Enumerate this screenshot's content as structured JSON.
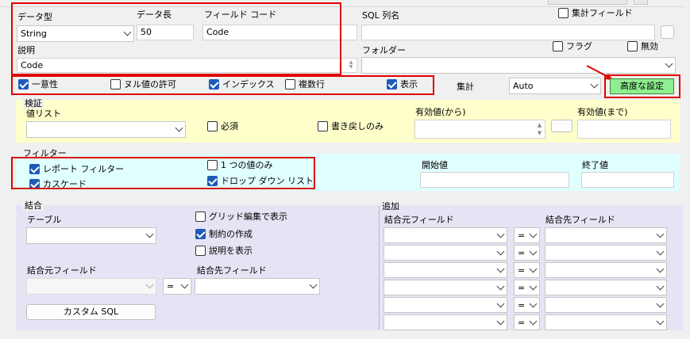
{
  "colors": {
    "accent": "#1e5bb8",
    "highlight": "#e00000",
    "valid_panel": "#ffffcc",
    "filter_panel": "#e0ffff",
    "join_panel": "#e4e4f4",
    "advanced_button_bg": "#90ee90"
  },
  "fields": {
    "data_type_label": "データ型",
    "data_type_value": "String",
    "data_length_label": "データ長",
    "data_length_value": "50",
    "field_code_label": "フィールド コード",
    "field_code_value": "Code",
    "description_label": "説明",
    "description_value": "Code",
    "sql_name_label": "SQL 列名",
    "sql_name_value": "",
    "aggregate_field_label": "集計フィールド",
    "folder_label": "フォルダー",
    "folder_value": "",
    "flag_label": "フラグ",
    "disabled_label": "無効"
  },
  "attrs": {
    "unique_label": "一意性",
    "nullable_label": "ヌル値の許可",
    "index_label": "インデックス",
    "multiline_label": "複数行",
    "display_label": "表示",
    "aggregate_label": "集計",
    "aggregate_value": "Auto",
    "advanced_button": "高度な設定"
  },
  "validation": {
    "title": "検証",
    "value_list_label": "値リスト",
    "required_label": "必須",
    "writeback_only_label": "書き戻しのみ",
    "valid_from_label": "有効値(から)",
    "valid_to_label": "有効値(まで)"
  },
  "filter": {
    "title": "フィルター",
    "report_filter_label": "レポート フィルター",
    "cascade_label": "カスケード",
    "single_value_label": "1 つの値のみ",
    "dropdown_list_label": "ドロップ ダウン リスト",
    "start_label": "開始値",
    "end_label": "終了値"
  },
  "join": {
    "title": "結合",
    "table_label": "テーブル",
    "show_grid_edit_label": "グリッド編集で表示",
    "create_constraint_label": "制約の作成",
    "show_description_label": "説明を表示",
    "source_field_label": "結合元フィールド",
    "target_field_label": "結合先フィールド",
    "operator": "=",
    "custom_sql_button": "カスタム SQL",
    "add_title": "追加",
    "add_source_label": "結合元フィールド",
    "add_target_label": "結合先フィールド",
    "add_rows": [
      "=",
      "=",
      "=",
      "=",
      "=",
      "="
    ]
  }
}
